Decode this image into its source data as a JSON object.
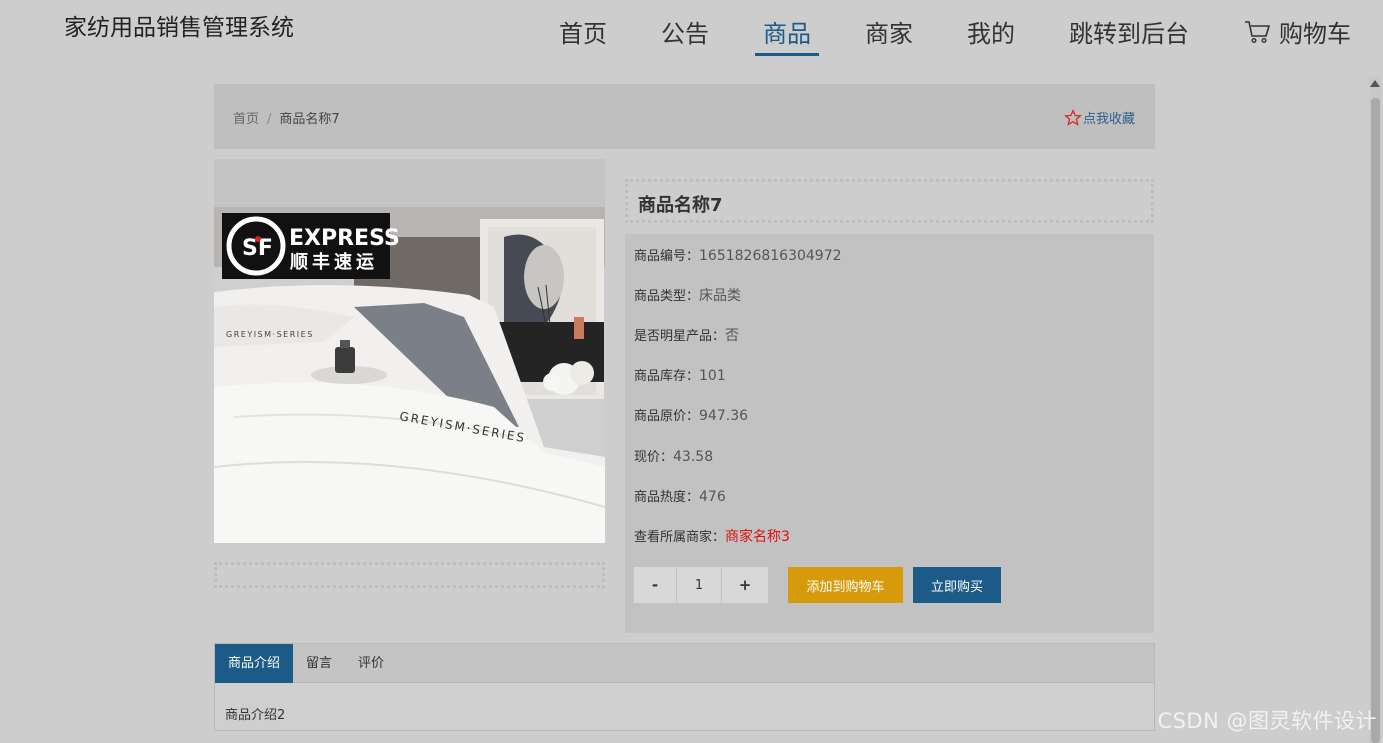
{
  "header": {
    "title": "家纺用品销售管理系统",
    "nav": [
      "首页",
      "公告",
      "商品",
      "商家",
      "我的",
      "跳转到后台"
    ],
    "cart": "购物车"
  },
  "breadcrumb": {
    "home": "首页",
    "separator": "/",
    "current": "商品名称7"
  },
  "favorite": "点我收藏",
  "photo": {
    "logo_line1": "EXPRESS",
    "logo_line2": "顺丰速运",
    "logo_mark": "SF",
    "series_text": "GREYISM·SERIES"
  },
  "product": {
    "name": "商品名称7",
    "fields": [
      {
        "key": "商品编号：",
        "value": "1651826816304972"
      },
      {
        "key": "商品类型：",
        "value": "床品类"
      },
      {
        "key": "是否明星产品：",
        "value": "否"
      },
      {
        "key": "商品库存：",
        "value": "101"
      },
      {
        "key": "商品原价：",
        "value": "947.36"
      },
      {
        "key": "现价：",
        "value": "43.58"
      },
      {
        "key": "商品热度：",
        "value": "476"
      },
      {
        "key": "查看所属商家：",
        "value": "商家名称3"
      }
    ]
  },
  "quantity": {
    "minus": "-",
    "value": "1",
    "plus": "+"
  },
  "actions": {
    "add_to_cart": "添加到购物车",
    "buy_now": "立即购买"
  },
  "tabs": {
    "items": [
      "商品介绍",
      "留言",
      "评价"
    ],
    "content": "商品介绍2"
  },
  "watermark": "CSDN @图灵软件设计",
  "colors": {
    "primary": "#1c5a88",
    "cart_button": "#d79a0a",
    "merchant_link": "#dd1111"
  }
}
